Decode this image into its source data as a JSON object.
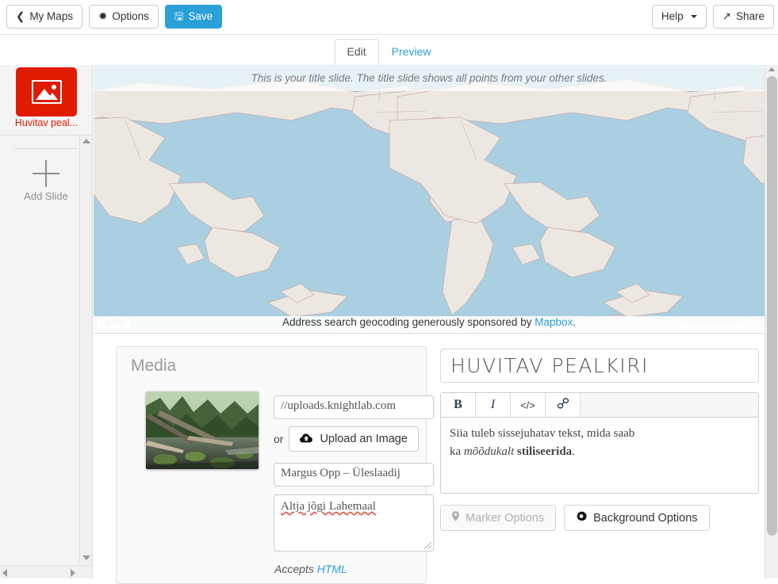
{
  "header": {
    "my_maps_label": "My Maps",
    "options_label": "Options",
    "save_label": "Save",
    "help_label": "Help",
    "share_label": "Share",
    "primary_color": "#2b9fd8"
  },
  "tabs": [
    {
      "label": "Edit",
      "active": true
    },
    {
      "label": "Preview",
      "active": false
    }
  ],
  "sidebar": {
    "slide": {
      "label": "Huvitav peal...",
      "color": "#e01b00",
      "icon": "picture-icon"
    },
    "add_slide_label": "Add Slide"
  },
  "map": {
    "title_note": "This is your title slide. The title slide shows all points from your other slides.",
    "attribution_badge": "Leaflet",
    "geocoding_note_prefix": "Address search geocoding generously sponsored by ",
    "geocoding_link": "Mapbox",
    "geocoding_note_suffix": ".",
    "ocean_color": "#a9cfe0",
    "land_color": "#ece8e1",
    "border_color": "#c9a8ad"
  },
  "media": {
    "panel_title": "Media",
    "url_value": "//uploads.knightlab.com",
    "or_label": "or",
    "upload_label": "Upload an Image",
    "credit_value": "Margus Opp – Üleslaadij",
    "caption_value": "Altja jõgi Lahemaal",
    "accepts_prefix": "Accepts ",
    "accepts_link": "HTML"
  },
  "text": {
    "title_value": "HUVITAV PEALKIRI",
    "toolbar": {
      "bold_label": "B",
      "italic_label": "I",
      "code_label": "</>",
      "link_label": "link-icon"
    },
    "body_line1": "Siia tuleb sissejuhatav tekst, mida saab",
    "body_line2_plain_a": "ka ",
    "body_line2_italic": "mõõdukalt",
    "body_line2_plain_b": " ",
    "body_line2_bold": "stiliseerida",
    "body_line2_plain_c": "."
  },
  "options": {
    "marker_label": "Marker Options",
    "background_label": "Background Options"
  }
}
